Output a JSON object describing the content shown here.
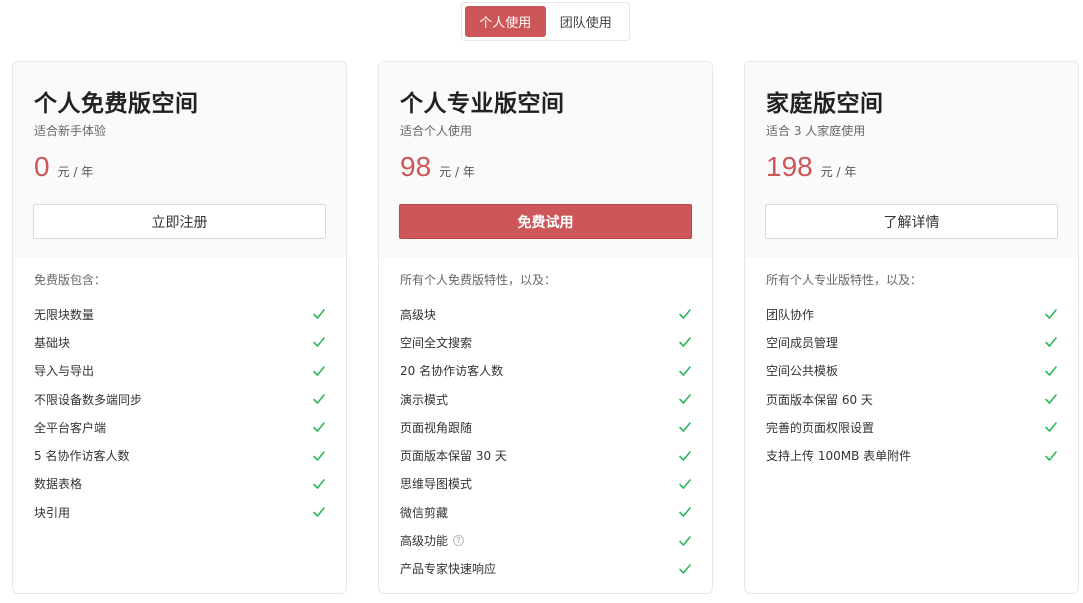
{
  "toggle": {
    "personal": "个人使用",
    "team": "团队使用"
  },
  "plans": [
    {
      "title": "个人免费版空间",
      "subtitle": "适合新手体验",
      "price": "0",
      "unit": "元 / 年",
      "button": "立即注册",
      "intro": "免费版包含：",
      "features": [
        "无限块数量",
        "基础块",
        "导入与导出",
        "不限设备数多端同步",
        "全平台客户端",
        "5 名协作访客人数",
        "数据表格",
        "块引用"
      ]
    },
    {
      "title": "个人专业版空间",
      "subtitle": "适合个人使用",
      "price": "98",
      "unit": "元 / 年",
      "button": "免费试用",
      "intro": "所有个人免费版特性，以及：",
      "features": [
        "高级块",
        "空间全文搜索",
        "20 名协作访客人数",
        "演示模式",
        "页面视角跟随",
        "页面版本保留 30 天",
        "思维导图模式",
        "微信剪藏",
        "高级功能",
        "产品专家快速响应"
      ]
    },
    {
      "title": "家庭版空间",
      "subtitle": "适合 3 人家庭使用",
      "price": "198",
      "unit": "元 / 年",
      "button": "了解详情",
      "intro": "所有个人专业版特性，以及：",
      "features": [
        "团队协作",
        "空间成员管理",
        "空间公共模板",
        "页面版本保留 60 天",
        "完善的页面权限设置",
        "支持上传 100MB 表单附件"
      ]
    }
  ],
  "colors": {
    "accent": "#cd5658",
    "check": "#2eb85c"
  },
  "icons": {
    "check": "check-icon",
    "help": "help-icon"
  }
}
